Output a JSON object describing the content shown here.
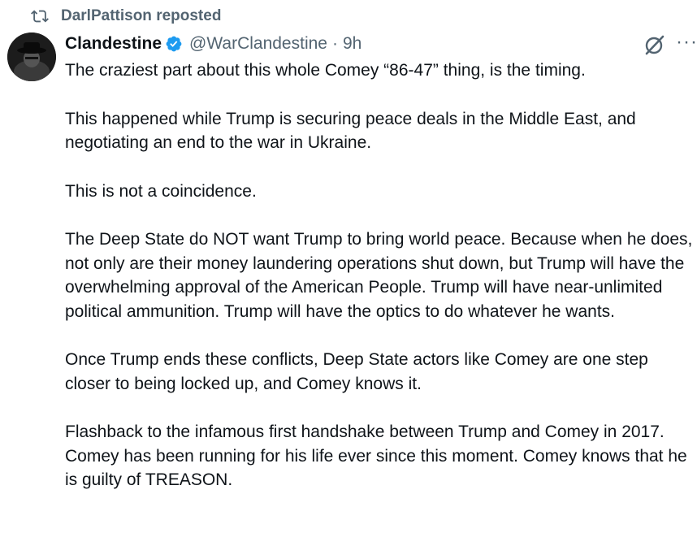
{
  "repost": {
    "text": "DarlPattison reposted",
    "icon": "repost-icon"
  },
  "author": {
    "display_name": "Clandestine",
    "verified": true,
    "verified_color": "#1d9bf0",
    "handle": "@WarClandestine",
    "separator": "·",
    "time": "9h"
  },
  "actions": {
    "grok_icon": "grok-icon",
    "more_icon": "more-icon",
    "more_label": "···"
  },
  "tweet": {
    "paragraphs": [
      "The craziest part about this whole Comey “86-47” thing, is the timing.",
      "This happened while Trump is securing peace deals in the Middle East, and negotiating an end to the war in Ukraine.",
      "This is not a coincidence.",
      "The Deep State do NOT want Trump to bring world peace. Because when he does, not only are their money laundering operations shut down, but Trump will have the overwhelming approval of the American People. Trump will have near-unlimited political ammunition. Trump will have the optics to do whatever he wants.",
      "Once Trump ends these conflicts, Deep State actors like Comey are one step closer to being locked up, and Comey knows it.",
      "Flashback to the infamous first handshake between Trump and Comey in 2017. Comey has been running for his life ever since this moment. Comey knows that he is guilty of TREASON."
    ]
  },
  "colors": {
    "text_primary": "#0f1419",
    "text_secondary": "#536471",
    "accent": "#1d9bf0"
  }
}
